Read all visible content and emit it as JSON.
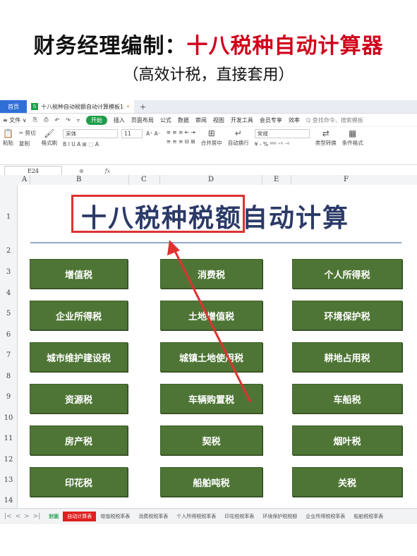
{
  "hero": {
    "title_black": "财务经理编制：",
    "title_red": "十八税种自动计算器",
    "subtitle": "（高效计税，直接套用）"
  },
  "app": {
    "tab_home": "首页",
    "tab_doc": "十八税种自动税额自动计算模板1",
    "doc_icon": "S",
    "tab_dot": "•",
    "plus": "+"
  },
  "menu": [
    "≡ 文件 ∨",
    "⎘",
    "⎙",
    "↶",
    "↷",
    "▿"
  ],
  "menu_start": "开始",
  "menu_items": [
    "插入",
    "页面布局",
    "公式",
    "数据",
    "审阅",
    "视图",
    "开发工具",
    "会员专享",
    "效率"
  ],
  "menu_search": "Q 查找命令、搜索模板",
  "ribbon": {
    "cut": "✂ 剪切",
    "paste": "粘贴",
    "copy": "复制",
    "format_painter": "格式刷",
    "font": "宋体",
    "size": "11",
    "font_row2": "B  I  U  A  ⊞  ⬚  A",
    "align_row1": "≡ ≡ ≡ ⇤ ⇥",
    "align_row2": "≡ ≡ ≡ ⊟ ⊞",
    "merge": "合并居中",
    "wrap": "自动换行",
    "numfmt": "常规",
    "numrow2": "¥ - % ⁰⁰⁰ ⁺⁰ ⁻⁰",
    "type_convert": "类型转换",
    "cond_format": "条件格式",
    "sheet_btn": "表格"
  },
  "formula_bar": {
    "name_box": "E24",
    "fx": "fx"
  },
  "columns": [
    "A",
    "B",
    "C",
    "D",
    "E",
    "F"
  ],
  "rows": [
    "1",
    "2",
    "3",
    "4",
    "5",
    "6",
    "7",
    "8",
    "9",
    "10",
    "11",
    "12",
    "13",
    "14"
  ],
  "sheet": {
    "title": "十八税种税额自动计算",
    "buttons": [
      "增值税",
      "消费税",
      "个人所得税",
      "企业所得税",
      "土地增值税",
      "环境保护税",
      "城市维护建设税",
      "城镇土地使用税",
      "耕地占用税",
      "资源税",
      "车辆购置税",
      "车船税",
      "房产税",
      "契税",
      "烟叶税",
      "印花税",
      "船舶吨税",
      "关税"
    ]
  },
  "sheet_tabs": [
    "封面",
    "自动计算表",
    "增值税税率表",
    "消费税税率表",
    "个人所得税税率表",
    "印花税税率表",
    "环境保护税税额",
    "企业所得税税率表",
    "船舶税税率表"
  ],
  "sheet_nav": [
    "|<",
    "<",
    ">",
    ">|"
  ],
  "colors": {
    "button_green": "#4e7535",
    "highlight_red": "#e03131",
    "title_navy": "#2b3a67"
  }
}
